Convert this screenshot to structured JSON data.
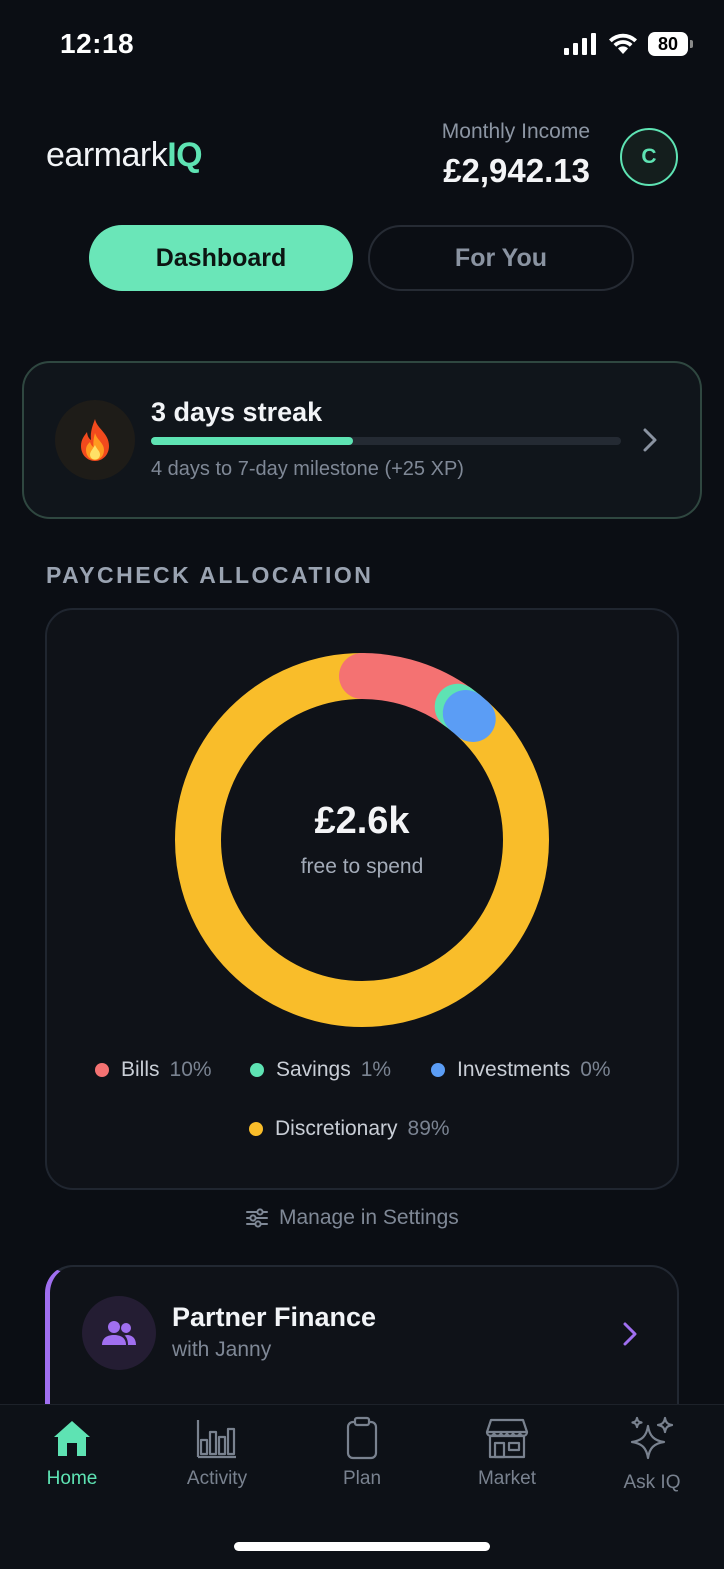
{
  "status_bar": {
    "time": "12:18",
    "battery": "80"
  },
  "header": {
    "logo_prefix": "earmark",
    "logo_suffix": "IQ",
    "income_label": "Monthly Income",
    "income_value": "£2,942.13",
    "avatar_initial": "C"
  },
  "tabs": [
    {
      "label": "Dashboard",
      "active": true
    },
    {
      "label": "For You",
      "active": false
    }
  ],
  "streak": {
    "icon": "fire-icon",
    "title": "3 days streak",
    "subtitle": "4 days to 7-day milestone (+25 XP)",
    "progress": 0.43
  },
  "allocation": {
    "section_title": "PAYCHECK ALLOCATION",
    "center_value": "£2.6k",
    "center_label": "free to spend",
    "legend": [
      {
        "label": "Bills",
        "pct": "10%",
        "color": "#f47272"
      },
      {
        "label": "Savings",
        "pct": "1%",
        "color": "#5ee3b3"
      },
      {
        "label": "Investments",
        "pct": "0%",
        "color": "#5b9df5"
      },
      {
        "label": "Discretionary",
        "pct": "89%",
        "color": "#f9bd2a"
      }
    ],
    "manage_label": "Manage in Settings"
  },
  "partner": {
    "title": "Partner Finance",
    "subtitle": "with Janny",
    "accent": "#a06ff0"
  },
  "bottom_nav": [
    {
      "label": "Home",
      "icon": "home-icon",
      "active": true
    },
    {
      "label": "Activity",
      "icon": "bar-chart-icon",
      "active": false
    },
    {
      "label": "Plan",
      "icon": "clipboard-icon",
      "active": false
    },
    {
      "label": "Market",
      "icon": "store-icon",
      "active": false
    },
    {
      "label": "Ask IQ",
      "icon": "sparkles-icon",
      "active": false
    }
  ]
}
